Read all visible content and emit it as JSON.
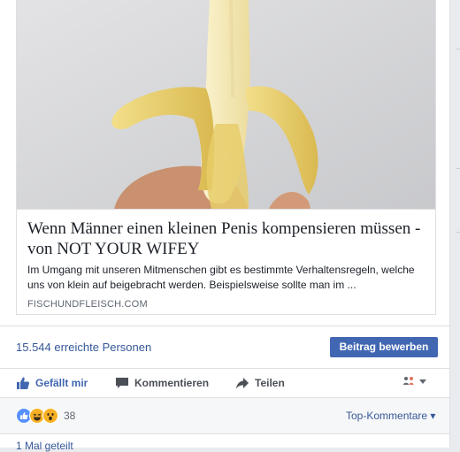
{
  "link": {
    "title": "Wenn Männer einen kleinen Penis kompensieren müssen - von NOT YOUR WIFEY",
    "description": "Im Umgang mit unseren Mitmenschen gibt es bestimmte Verhaltensregeln, welche uns von klein auf beigebracht werden. Beispielsweise sollte man im ...",
    "domain": "FISCHUNDFLEISCH.COM"
  },
  "stats": {
    "reach": "15.544 erreichte Personen",
    "boost_label": "Beitrag bewerben"
  },
  "actions": {
    "like": "Gefällt mir",
    "comment": "Kommentieren",
    "share": "Teilen"
  },
  "reactions": {
    "count": "38",
    "top_comments": "Top-Kommentare ▾"
  },
  "shares": "1 Mal geteilt",
  "colors": {
    "brand": "#4267b2",
    "link": "#365899",
    "like_blue": "#5890ff",
    "reaction_yellow": "#f7b125"
  },
  "icons": [
    "like-thumb-icon",
    "comment-bubble-icon",
    "share-arrow-icon",
    "audience-icon",
    "dropdown-caret-icon",
    "reaction-like-icon",
    "reaction-haha-icon",
    "reaction-wow-icon"
  ]
}
